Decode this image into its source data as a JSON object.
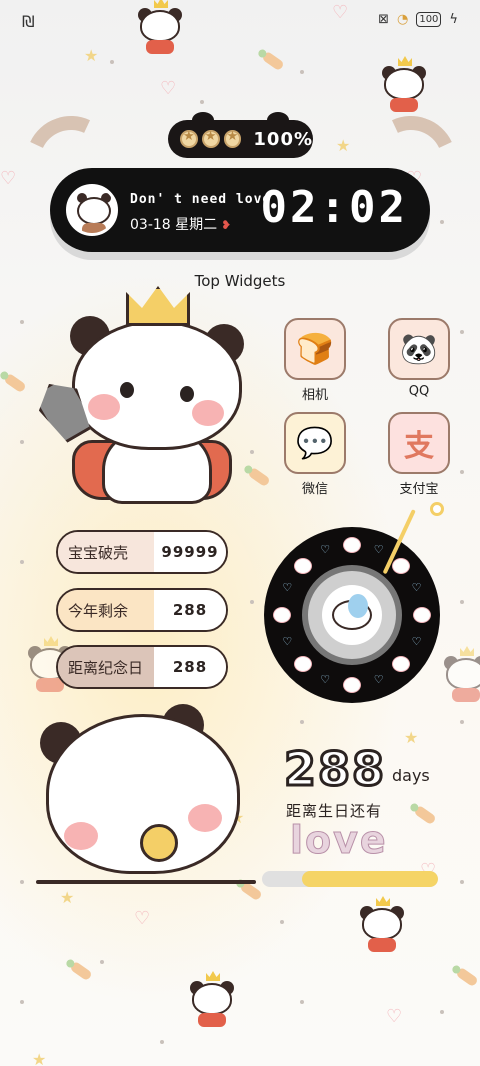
{
  "status_bar": {
    "left_icon": "nfc-icon",
    "right_icons": [
      "sim-off-icon",
      "wifi-icon"
    ],
    "battery": "100",
    "charging_icon": "bolt-icon"
  },
  "battery_widget": {
    "percent": "100%",
    "icons": [
      "cookie-star-icon",
      "cookie-star-icon",
      "cookie-star-icon"
    ]
  },
  "clock_widget": {
    "quote": "Don' t need love",
    "date": "03-18 星期二",
    "time": "02:02"
  },
  "section_title": "Top Widgets",
  "apps": [
    {
      "label": "相机",
      "icon": "camera-icon",
      "glyph": "🍞",
      "bg": "#fbe7dd"
    },
    {
      "label": "QQ",
      "icon": "qq-icon",
      "glyph": "🐼",
      "bg": "#fbe7dd"
    },
    {
      "label": "微信",
      "icon": "wechat-icon",
      "glyph": "💬",
      "bg": "#fdf2d6"
    },
    {
      "label": "支付宝",
      "icon": "alipay-icon",
      "glyph": "支",
      "bg": "#fde1df"
    }
  ],
  "stats": [
    {
      "label": "宝宝破壳",
      "value": "99999",
      "color": "#f7e6dc"
    },
    {
      "label": "今年剩余",
      "value": "288",
      "color": "#fbe5c4"
    },
    {
      "label": "距离纪念日",
      "value": "288",
      "color": "#dcc5b9"
    }
  ],
  "countdown": {
    "days": "288",
    "unit": "days",
    "caption": "距离生日还有",
    "word": "love",
    "progress_fraction": 0.77
  },
  "colors": {
    "accent_yellow": "#f5d466",
    "dark": "#111111"
  }
}
